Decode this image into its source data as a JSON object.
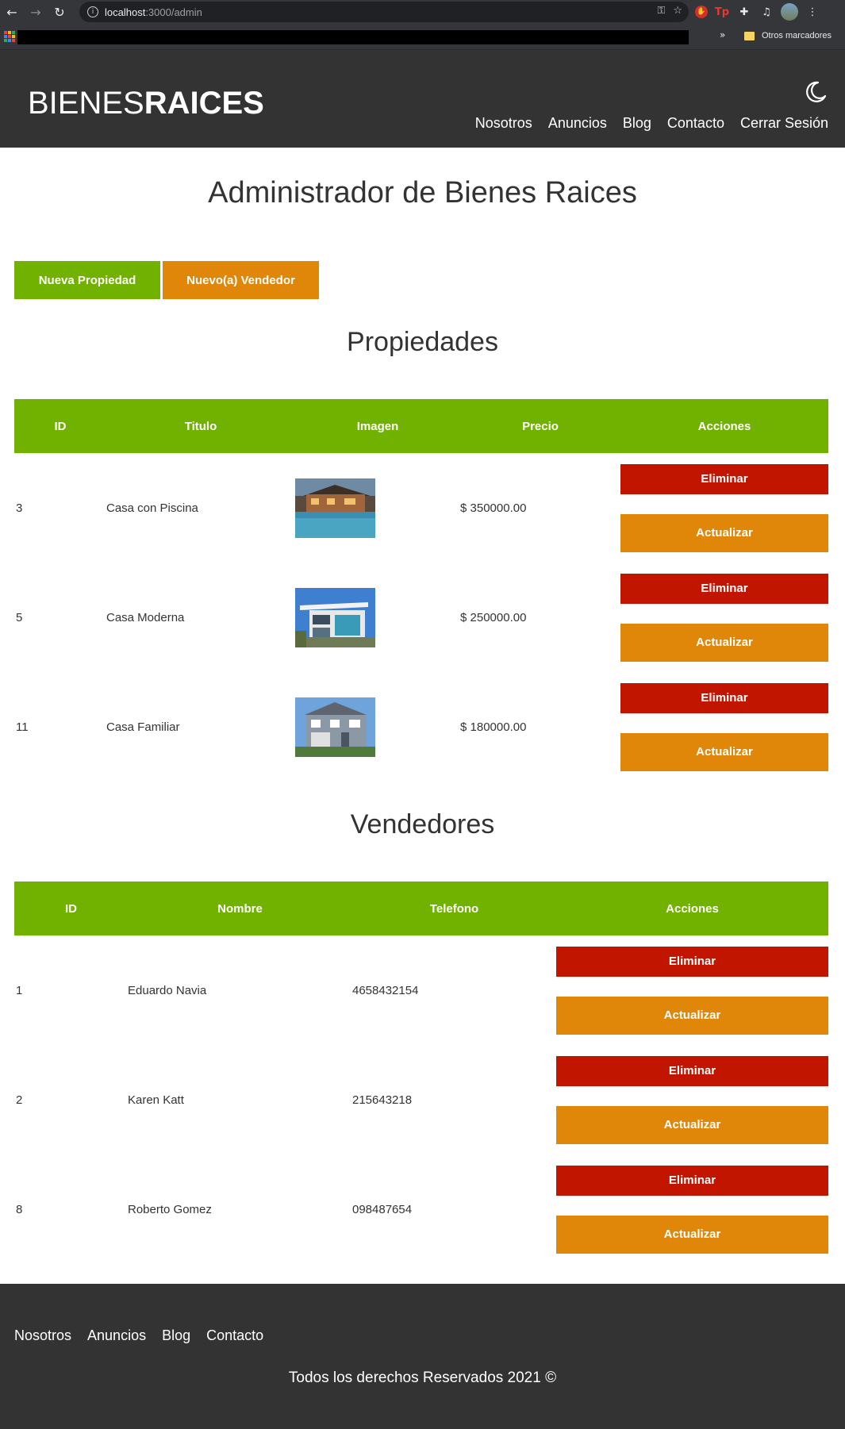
{
  "browser": {
    "url_host": "localhost",
    "url_path": ":3000/admin",
    "bookmarks_more": "»",
    "other_bookmarks": "Otros marcadores"
  },
  "header": {
    "logo_light": "BIENES",
    "logo_bold": "RAICES",
    "nav": [
      "Nosotros",
      "Anuncios",
      "Blog",
      "Contacto",
      "Cerrar Sesión"
    ]
  },
  "main": {
    "title": "Administrador de Bienes Raices",
    "new_property": "Nueva Propiedad",
    "new_seller": "Nuevo(a) Vendedor"
  },
  "properties": {
    "title": "Propiedades",
    "headers": [
      "ID",
      "Titulo",
      "Imagen",
      "Precio",
      "Acciones"
    ],
    "rows": [
      {
        "id": "3",
        "title": "Casa con Piscina",
        "price": "$ 350000.00"
      },
      {
        "id": "5",
        "title": "Casa Moderna",
        "price": "$ 250000.00"
      },
      {
        "id": "11",
        "title": "Casa Familiar",
        "price": "$ 180000.00"
      }
    ]
  },
  "sellers": {
    "title": "Vendedores",
    "headers": [
      "ID",
      "Nombre",
      "Telefono",
      "Acciones"
    ],
    "rows": [
      {
        "id": "1",
        "name": "Eduardo Navia",
        "phone": "4658432154"
      },
      {
        "id": "2",
        "name": "Karen Katt",
        "phone": "215643218"
      },
      {
        "id": "8",
        "name": "Roberto Gomez",
        "phone": "098487654"
      }
    ]
  },
  "actions": {
    "delete": "Eliminar",
    "update": "Actualizar"
  },
  "footer": {
    "nav": [
      "Nosotros",
      "Anuncios",
      "Blog",
      "Contacto"
    ],
    "copyright": "Todos los derechos Reservados 2021 ©"
  },
  "colors": {
    "green": "#71b100",
    "orange": "#e08709",
    "red": "#c21500",
    "dark": "#333333"
  }
}
